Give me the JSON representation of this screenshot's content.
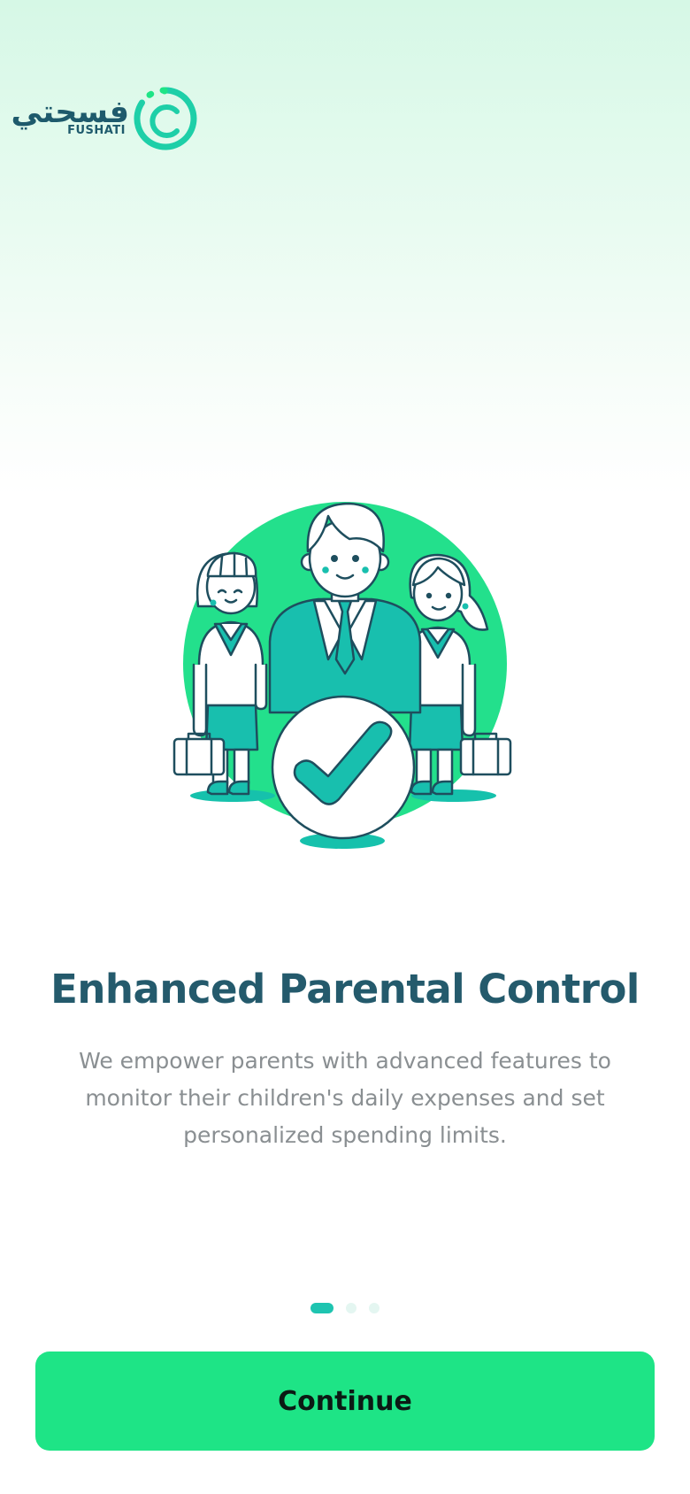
{
  "brand": {
    "arabic_name": "فسحتي",
    "latin_name": "FUSHATI"
  },
  "onboarding": {
    "title": "Enhanced Parental Control",
    "description": "We empower parents with advanced features to monitor their children's daily expenses and set personalized spending limits.",
    "current_page": 1,
    "total_pages": 3,
    "continue_label": "Continue",
    "illustration_icon": "parent-with-children-checkmark-icon"
  },
  "colors": {
    "brand_green": "#1ee486",
    "brand_teal": "#1ec4b0",
    "title_color": "#245a6c",
    "description_color": "#8a8f92",
    "dot_inactive": "#e4f6f1"
  }
}
